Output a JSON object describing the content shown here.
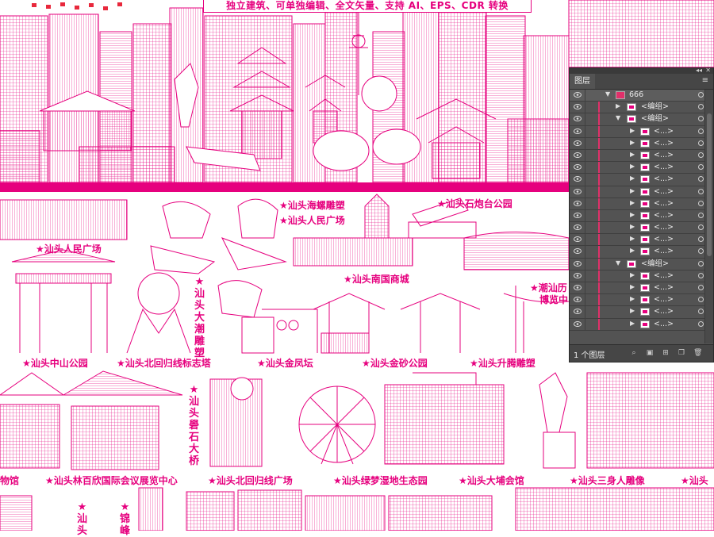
{
  "banner": {
    "text": "独立建筑、可单独编辑、全文矢量、支持 AI、EPS、CDR 转换"
  },
  "labels": {
    "shantou_renmin_guangchang": "★汕头人民广场",
    "haibo": "★汕头海螺雕塑",
    "renmin2": "★汕头人民广场",
    "shipao": "★汕头石炮台公园",
    "nanguo": "★汕头南国商城",
    "chaoshan": "★潮汕历",
    "bolan": "博览中",
    "zhongshan": "★汕头中山公园",
    "beihuigui": "★汕头北回归线标志塔",
    "jinfeng": "★汕头金凤坛",
    "jinsha": "★汕头金砂公园",
    "shengteng": "★汕头升腾雕塑",
    "bowuguan": "物馆",
    "linbaixin": "★汕头林百欣国际会议展览中心",
    "beihuigui_gc": "★汕头北回归线广场",
    "lvmeng": "★汕头绿梦湿地生态园",
    "dapu": "★汕头大埔会馆",
    "sanshen": "★汕头三身人雕像",
    "last": "★汕头"
  },
  "vlabels": {
    "dachao": "★汕头大潮雕塑",
    "queshi": "★汕头礐石大桥",
    "bottom1": "★汕头",
    "bottom2": "★锦峰"
  },
  "layers_panel": {
    "tab": "图层",
    "layer_count": "1 个图层",
    "top_layer": "666",
    "group_label": "<编组>",
    "item_label": "<...>"
  },
  "colors": {
    "accent": "#e6007e",
    "panel_bg": "#535353",
    "layer_color": "#e0306a"
  }
}
